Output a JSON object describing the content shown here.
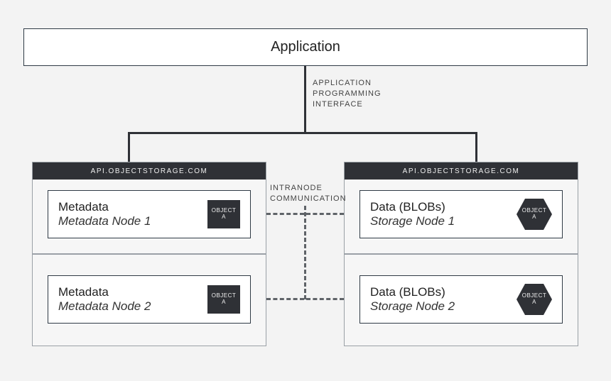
{
  "app": {
    "title": "Application"
  },
  "labels": {
    "api_l1": "APPLICATION",
    "api_l2": "PROGRAMMING",
    "api_l3": "INTERFACE",
    "intra_l1": "INTRANODE",
    "intra_l2": "COMMUNICATION"
  },
  "clusters": {
    "left": {
      "header": "API.OBJECTSTORAGE.COM"
    },
    "right": {
      "header": "API.OBJECTSTORAGE.COM"
    }
  },
  "nodes": {
    "m1": {
      "title": "Metadata",
      "sub": "Metadata Node 1",
      "obj_l1": "OBJECT",
      "obj_l2": "A"
    },
    "m2": {
      "title": "Metadata",
      "sub": "Metadata Node 2",
      "obj_l1": "OBJECT",
      "obj_l2": "A"
    },
    "d1": {
      "title": "Data (BLOBs)",
      "sub": "Storage Node 1",
      "obj_l1": "OBJECT",
      "obj_l2": "A"
    },
    "d2": {
      "title": "Data (BLOBs)",
      "sub": "Storage Node 2",
      "obj_l1": "OBJECT",
      "obj_l2": "A"
    }
  },
  "colors": {
    "dark": "#2f3136"
  }
}
